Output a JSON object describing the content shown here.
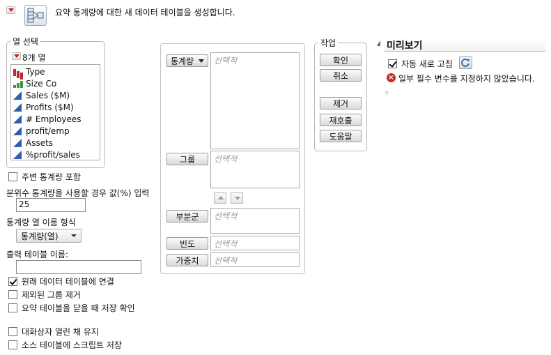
{
  "header": {
    "description": "요약 통계량에 대한 새 데이터 테이블을 생성합니다."
  },
  "columns_panel": {
    "legend": "열 선택",
    "count_label": "8개 열",
    "items": [
      {
        "label": "Type",
        "icon": "nominal-icon"
      },
      {
        "label": "Size Co",
        "icon": "ordinal-icon"
      },
      {
        "label": "Sales ($M)",
        "icon": "continuous-icon"
      },
      {
        "label": "Profits ($M)",
        "icon": "continuous-icon"
      },
      {
        "label": "# Employees",
        "icon": "continuous-icon"
      },
      {
        "label": "profit/emp",
        "icon": "continuous-icon"
      },
      {
        "label": "Assets",
        "icon": "continuous-icon"
      },
      {
        "label": "%profit/sales",
        "icon": "continuous-icon"
      }
    ]
  },
  "options": {
    "marginal_stats": "주변 통계량 포함",
    "quantile_label": "분위수 통계량을 사용할 경우 값(%) 입력",
    "quantile_value": "25",
    "stat_name_format_label": "통계량 열 이름 형식",
    "stat_name_format_value": "통계량(열)",
    "output_table_label": "출력 테이블 이름:",
    "output_table_value": "",
    "link_to_original": "원래 데이터 테이블에 연결",
    "exclude_groups": "제외된 그룹 제거",
    "confirm_save": "요약 테이블을 닫을 때 저장 확인",
    "keep_dialog_open": "대화상자 열린 채 유지",
    "save_script": "소스 테이블에 스크립트 저장"
  },
  "roles": {
    "statistics_button": "통계량",
    "group_button": "그룹",
    "subgroup_button": "부분군",
    "frequency_button": "빈도",
    "weight_button": "가중치",
    "optional": "선택적"
  },
  "actions": {
    "legend": "작업",
    "ok": "확인",
    "cancel": "취소",
    "remove": "제거",
    "recall": "재호출",
    "help": "도움말"
  },
  "preview": {
    "title": "미리보기",
    "auto_refresh": "자동 새로 고침",
    "error_message": "일부 필수 변수를 지정하지 않았습니다."
  }
}
